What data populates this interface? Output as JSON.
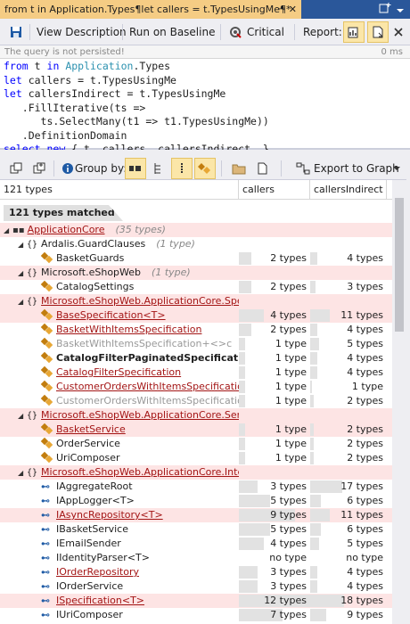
{
  "window": {
    "tab_title": "from t in Application.Types¶let callers = t.TypesUsingMe¶*",
    "pin_glyph": "⊸",
    "close_glyph": "✕"
  },
  "toolbar": {
    "view_description": "View Description",
    "run_on_baseline": "Run on Baseline",
    "critical": "Critical",
    "report_label": "Report:"
  },
  "status": {
    "message": "The query is not persisted!",
    "elapsed": "0 ms"
  },
  "query_lines": [
    "from t in Application.Types",
    "let callers = t.TypesUsingMe",
    "let callersIndirect = t.TypesUsingMe",
    "   .FillIterative(ts =>",
    "      ts.SelectMany(t1 => t1.TypesUsingMe))",
    "   .DefinitionDomain",
    "select new { t, callers, callersIndirect  }"
  ],
  "results_toolbar": {
    "group_by_label": "Group by:",
    "export_label": "Export to Graph"
  },
  "grid": {
    "col_types": "121 types",
    "col_callers": "callers",
    "col_callers_indirect": "callersIndirect",
    "matched_label": "121 types matched"
  },
  "rows": [
    {
      "indent": 4,
      "exp": "◢",
      "kind": "asm",
      "name": "ApplicationCore",
      "style": "red",
      "count": "(35 types)",
      "c1": "",
      "c2": "",
      "pink": true
    },
    {
      "indent": 20,
      "exp": "◢",
      "kind": "ns",
      "name": "Ardalis.GuardClauses",
      "style": "",
      "count": "(1 type)",
      "c1": "",
      "c2": "",
      "pink": false
    },
    {
      "indent": 46,
      "exp": "",
      "kind": "cls",
      "name": "BasketGuards",
      "style": "",
      "count": "",
      "c1": "2 types",
      "c2": "4 types",
      "b1": 14,
      "b2": 8,
      "pink": false
    },
    {
      "indent": 20,
      "exp": "◢",
      "kind": "ns",
      "name": "Microsoft.eShopWeb",
      "style": "",
      "count": "(1 type)",
      "c1": "",
      "c2": "",
      "pink": true
    },
    {
      "indent": 46,
      "exp": "",
      "kind": "cls",
      "name": "CatalogSettings",
      "style": "",
      "count": "",
      "c1": "2 types",
      "c2": "3 types",
      "b1": 14,
      "b2": 6,
      "pink": false
    },
    {
      "indent": 20,
      "exp": "◢",
      "kind": "ns",
      "name": "Microsoft.eShopWeb.ApplicationCore.Specifications",
      "style": "red",
      "count": "",
      "c1": "",
      "c2": "",
      "pink": true
    },
    {
      "indent": 46,
      "exp": "",
      "kind": "cls",
      "name": "BaseSpecification<T>",
      "style": "red",
      "count": "",
      "c1": "4 types",
      "c2": "11 types",
      "b1": 28,
      "b2": 22,
      "pink": true
    },
    {
      "indent": 46,
      "exp": "",
      "kind": "cls",
      "name": "BasketWithItemsSpecification",
      "style": "red",
      "count": "",
      "c1": "2 types",
      "c2": "4 types",
      "b1": 14,
      "b2": 8,
      "pink": false
    },
    {
      "indent": 46,
      "exp": "",
      "kind": "cls",
      "name": "BasketWithItemsSpecification+<>c",
      "style": "gray",
      "count": "",
      "c1": "1 type",
      "c2": "5 types",
      "b1": 7,
      "b2": 10,
      "pink": false
    },
    {
      "indent": 46,
      "exp": "",
      "kind": "cls",
      "name": "CatalogFilterPaginatedSpecification",
      "style": "bold",
      "count": "",
      "c1": "1 type",
      "c2": "4 types",
      "b1": 7,
      "b2": 8,
      "pink": false
    },
    {
      "indent": 46,
      "exp": "",
      "kind": "cls",
      "name": "CatalogFilterSpecification",
      "style": "red",
      "count": "",
      "c1": "1 type",
      "c2": "4 types",
      "b1": 7,
      "b2": 8,
      "pink": false
    },
    {
      "indent": 46,
      "exp": "",
      "kind": "cls",
      "name": "CustomerOrdersWithItemsSpecification",
      "style": "red",
      "count": "",
      "c1": "1 type",
      "c2": "1 type",
      "b1": 7,
      "b2": 2,
      "pink": false
    },
    {
      "indent": 46,
      "exp": "",
      "kind": "cls",
      "name": "CustomerOrdersWithItemsSpecification+<>c",
      "style": "gray",
      "count": "",
      "c1": "1 type",
      "c2": "2 types",
      "b1": 7,
      "b2": 4,
      "pink": false
    },
    {
      "indent": 20,
      "exp": "◢",
      "kind": "ns",
      "name": "Microsoft.eShopWeb.ApplicationCore.Services",
      "style": "red",
      "count": "",
      "c1": "",
      "c2": "",
      "pink": true
    },
    {
      "indent": 46,
      "exp": "",
      "kind": "cls",
      "name": "BasketService",
      "style": "red",
      "count": "",
      "c1": "1 type",
      "c2": "2 types",
      "b1": 7,
      "b2": 4,
      "pink": true
    },
    {
      "indent": 46,
      "exp": "",
      "kind": "cls",
      "name": "OrderService",
      "style": "",
      "count": "",
      "c1": "1 type",
      "c2": "2 types",
      "b1": 7,
      "b2": 4,
      "pink": false
    },
    {
      "indent": 46,
      "exp": "",
      "kind": "cls",
      "name": "UriComposer",
      "style": "",
      "count": "",
      "c1": "1 type",
      "c2": "2 types",
      "b1": 7,
      "b2": 4,
      "pink": false
    },
    {
      "indent": 20,
      "exp": "◢",
      "kind": "ns",
      "name": "Microsoft.eShopWeb.ApplicationCore.Interfaces",
      "style": "red",
      "count": "",
      "c1": "",
      "c2": "",
      "pink": true
    },
    {
      "indent": 46,
      "exp": "",
      "kind": "iface",
      "name": "IAggregateRoot",
      "style": "",
      "count": "",
      "c1": "3 types",
      "c2": "17 types",
      "b1": 21,
      "b2": 36,
      "pink": false
    },
    {
      "indent": 46,
      "exp": "",
      "kind": "iface",
      "name": "IAppLogger<T>",
      "style": "",
      "count": "",
      "c1": "5 types",
      "c2": "6 types",
      "b1": 35,
      "b2": 12,
      "pink": false
    },
    {
      "indent": 46,
      "exp": "",
      "kind": "iface",
      "name": "IAsyncRepository<T>",
      "style": "red",
      "count": "",
      "c1": "9 types",
      "c2": "11 types",
      "b1": 63,
      "b2": 22,
      "pink": true
    },
    {
      "indent": 46,
      "exp": "",
      "kind": "iface",
      "name": "IBasketService",
      "style": "",
      "count": "",
      "c1": "5 types",
      "c2": "6 types",
      "b1": 35,
      "b2": 12,
      "pink": false
    },
    {
      "indent": 46,
      "exp": "",
      "kind": "iface",
      "name": "IEmailSender",
      "style": "",
      "count": "",
      "c1": "4 types",
      "c2": "5 types",
      "b1": 28,
      "b2": 10,
      "pink": false
    },
    {
      "indent": 46,
      "exp": "",
      "kind": "iface",
      "name": "IIdentityParser<T>",
      "style": "",
      "count": "",
      "c1": "no type",
      "c2": "no type",
      "b1": 0,
      "b2": 0,
      "pink": false
    },
    {
      "indent": 46,
      "exp": "",
      "kind": "iface",
      "name": "IOrderRepository",
      "style": "red",
      "count": "",
      "c1": "3 types",
      "c2": "4 types",
      "b1": 21,
      "b2": 8,
      "pink": false
    },
    {
      "indent": 46,
      "exp": "",
      "kind": "iface",
      "name": "IOrderService",
      "style": "",
      "count": "",
      "c1": "3 types",
      "c2": "4 types",
      "b1": 21,
      "b2": 8,
      "pink": false
    },
    {
      "indent": 46,
      "exp": "",
      "kind": "iface",
      "name": "ISpecification<T>",
      "style": "red",
      "count": "",
      "c1": "12 types",
      "c2": "18 types",
      "b1": 80,
      "b2": 38,
      "pink": true
    },
    {
      "indent": 46,
      "exp": "",
      "kind": "iface",
      "name": "IUriComposer",
      "style": "",
      "count": "",
      "c1": "7 types",
      "c2": "9 types",
      "b1": 49,
      "b2": 18,
      "pink": false
    }
  ]
}
